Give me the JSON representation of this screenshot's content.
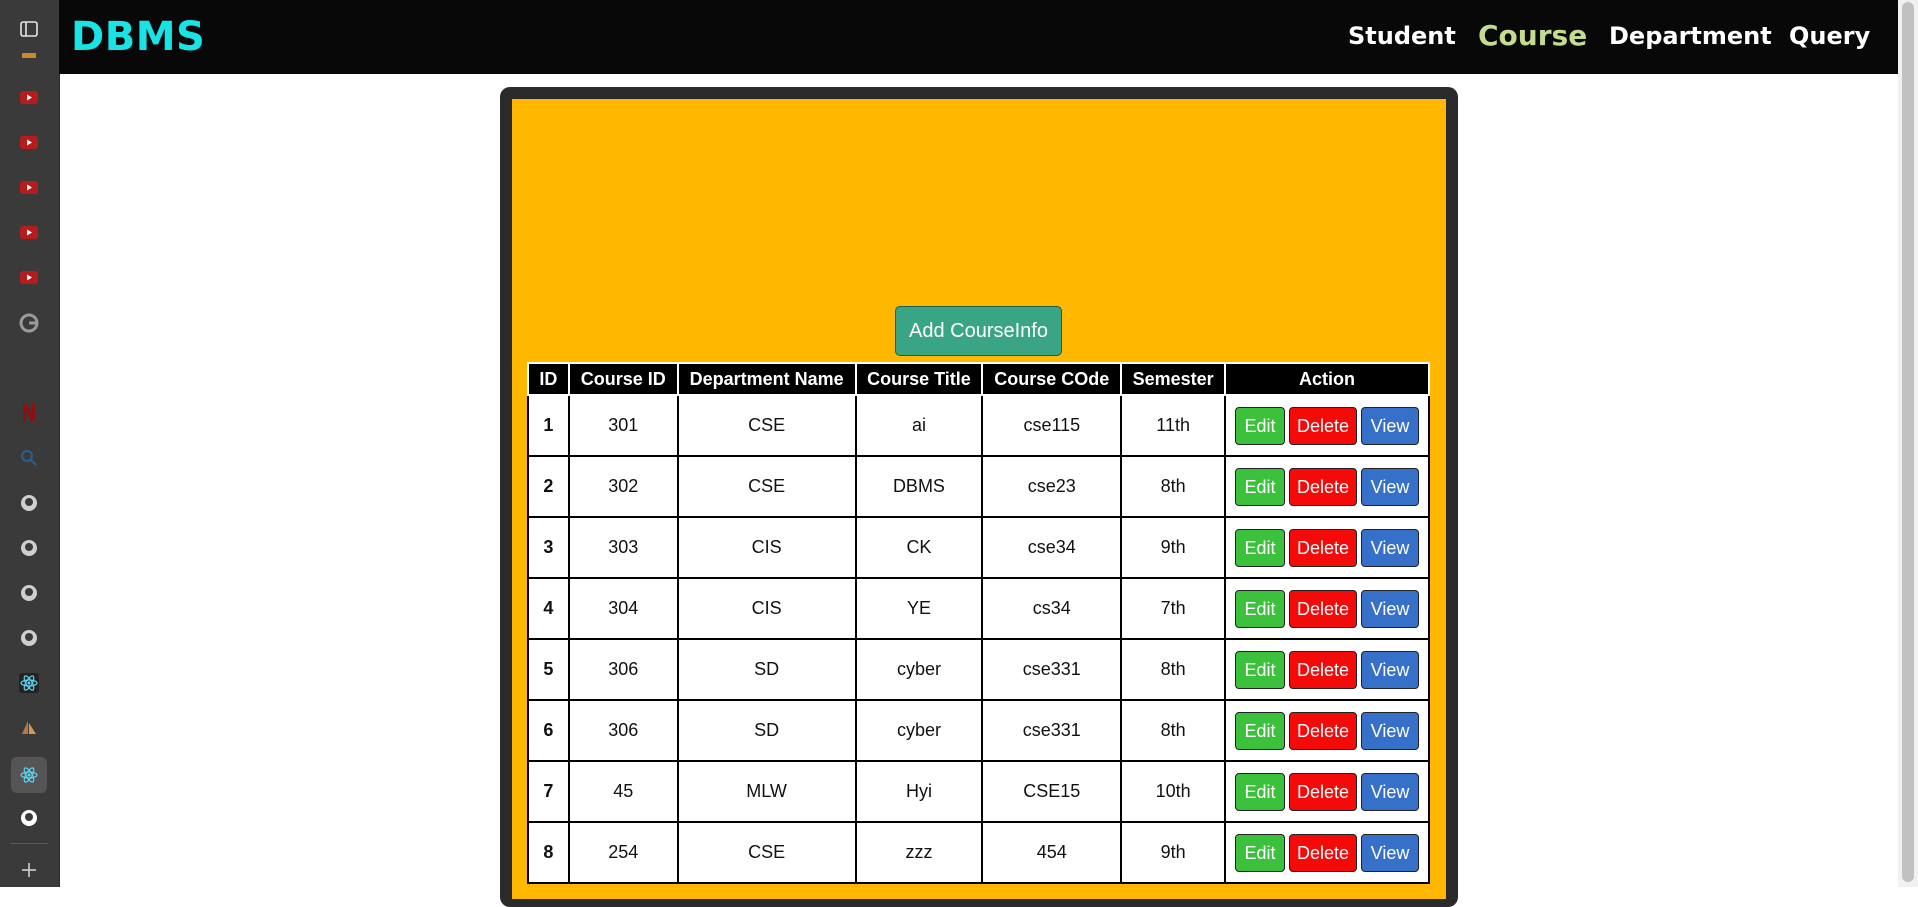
{
  "browser_sidebar": {
    "icons": [
      "panel-toggle-icon",
      "bookmark-icon",
      "youtube-icon",
      "youtube-icon",
      "youtube-icon",
      "youtube-icon",
      "youtube-icon",
      "google-icon",
      "netflix-icon",
      "search-icon",
      "github-icon",
      "github-icon",
      "github-icon",
      "github-icon",
      "react-icon",
      "sailboat-icon",
      "react-icon",
      "github-icon",
      "plus-icon"
    ]
  },
  "navbar": {
    "brand": "DBMS",
    "links": [
      "Student",
      "Course",
      "Department",
      "Query"
    ],
    "active": "Course"
  },
  "main": {
    "add_button": "Add CourseInfo",
    "table": {
      "headers": [
        "ID",
        "Course ID",
        "Department Name",
        "Course Title",
        "Course COde",
        "Semester",
        "Action"
      ],
      "rows": [
        [
          "1",
          "301",
          "CSE",
          "ai",
          "cse115",
          "11th"
        ],
        [
          "2",
          "302",
          "CSE",
          "DBMS",
          "cse23",
          "8th"
        ],
        [
          "3",
          "303",
          "CIS",
          "CK",
          "cse34",
          "9th"
        ],
        [
          "4",
          "304",
          "CIS",
          "YE",
          "cs34",
          "7th"
        ],
        [
          "5",
          "306",
          "SD",
          "cyber",
          "cse331",
          "8th"
        ],
        [
          "6",
          "306",
          "SD",
          "cyber",
          "cse331",
          "8th"
        ],
        [
          "7",
          "45",
          "MLW",
          "Hyi",
          "CSE15",
          "10th"
        ],
        [
          "8",
          "254",
          "CSE",
          "zzz",
          "454",
          "9th"
        ]
      ],
      "actions": [
        "Edit",
        "Delete",
        "View"
      ]
    }
  },
  "colors": {
    "brand": "#18e4e6",
    "active_link": "#c3dc8f",
    "panel": "#ffb700",
    "edit": "#3cc13c",
    "delete": "#f50a0a",
    "view": "#3670c8",
    "add": "#3aa584"
  }
}
